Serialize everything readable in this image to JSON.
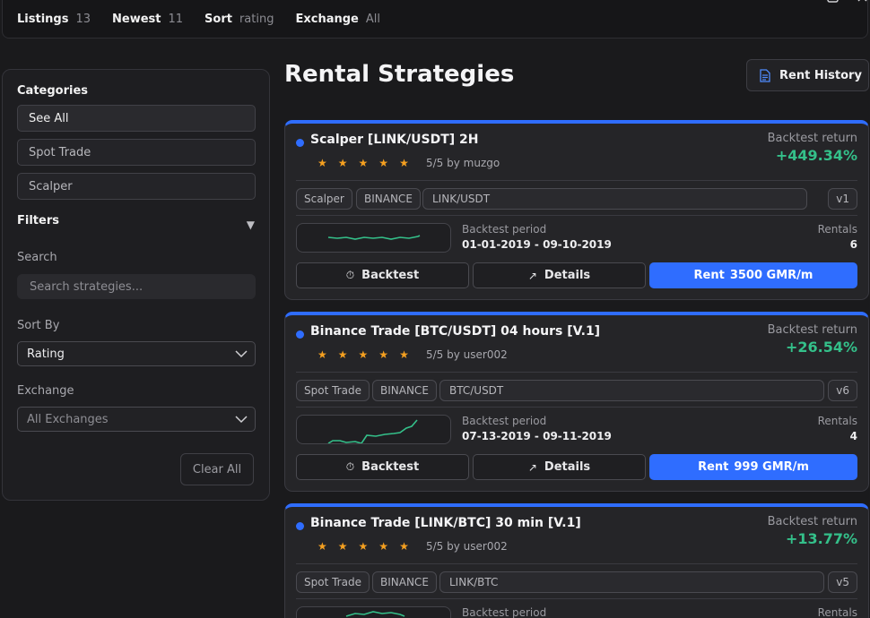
{
  "topbar": {
    "stats": [
      {
        "key": "Listings",
        "value": "13"
      },
      {
        "key": "Newest",
        "value": "11"
      },
      {
        "key": "Sort",
        "value": "rating"
      },
      {
        "key": "Exchange",
        "value": "All"
      }
    ],
    "window_controls": [
      "minimize-icon",
      "maximize-icon",
      "close-icon"
    ]
  },
  "sidebar": {
    "categories_title": "Categories",
    "categories": [
      "See All",
      "Spot Trade",
      "Scalper"
    ],
    "filters_title": "Filters",
    "filters_toggle_icon": "caret-down-icon",
    "search_label": "Search",
    "search_placeholder": "Search strategies...",
    "sort_label": "Sort By",
    "sort_value": "Rating",
    "exchange_label": "Exchange",
    "exchange_value": "All Exchanges",
    "clear_label": "Clear All"
  },
  "main": {
    "title": "Rental Strategies",
    "rent_history_label": "Rent History",
    "rent_history_icon": "document-icon",
    "stars_count": 5,
    "labels": {
      "return": "Backtest return",
      "period": "Backtest period",
      "rentals": "Rentals",
      "backtest_btn": "Backtest",
      "details_btn": "Details",
      "rent_btn": "Rent"
    },
    "accent": "#2f6dff",
    "positive": "#34c08a",
    "strategies": [
      {
        "name": "Scalper [LINK/USDT] 2H",
        "rating": "5/5 by muzgo",
        "return": "+449.34%",
        "category": "Scalper",
        "exchange": "BINANCE",
        "pair": "LINK/USDT",
        "version": "v1",
        "period": "01-01-2019 - 09-10-2019",
        "rentals": "6",
        "price": "3500 GMR/m"
      },
      {
        "name": "Binance Trade [BTC/USDT] 04 hours [V.1]",
        "rating": "5/5 by user002",
        "return": "+26.54%",
        "category": "Spot Trade",
        "exchange": "BINANCE",
        "pair": "BTC/USDT",
        "version": "v6",
        "period": "07-13-2019 - 09-11-2019",
        "rentals": "4",
        "price": "999 GMR/m"
      },
      {
        "name": "Binance Trade [LINK/BTC] 30 min [V.1]",
        "rating": "5/5 by user002",
        "return": "+13.77%",
        "category": "Spot Trade",
        "exchange": "BINANCE",
        "pair": "LINK/BTC",
        "version": "v5",
        "period": "",
        "rentals": "",
        "price": ""
      }
    ]
  }
}
